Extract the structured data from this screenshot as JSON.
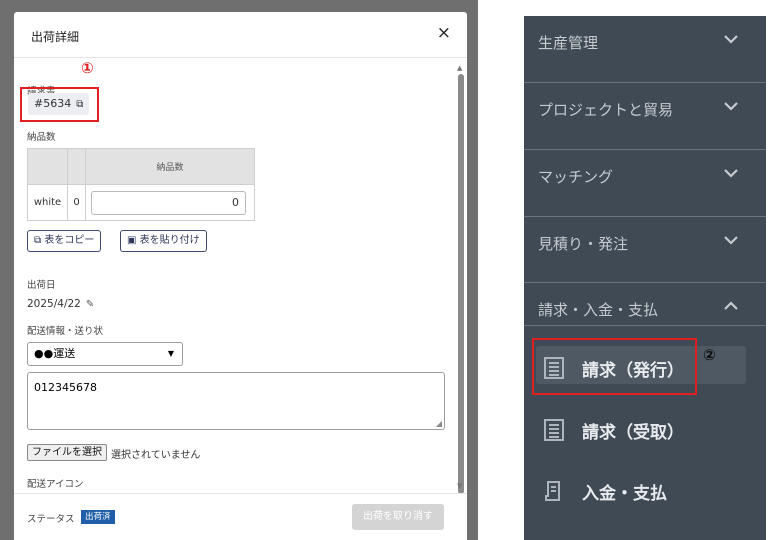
{
  "modal": {
    "title": "出荷詳細",
    "close": "×",
    "invoice_label": "請求書",
    "invoice_number": "#5634",
    "annotation_1": "①",
    "qty_label": "納品数",
    "qty_table": {
      "header": "納品数",
      "row_label": "white",
      "row_count": "0",
      "input_value": "0"
    },
    "copy_table": "表をコピー",
    "paste_table": "表を貼り付け",
    "ship_date_label": "出荷日",
    "ship_date": "2025/4/22",
    "delivery_label": "配送情報・送り状",
    "carrier": "●●運送",
    "tracking": "012345678",
    "file_button": "ファイルを選択",
    "file_status": "選択されていません",
    "ship_icon_label": "配送アイコン",
    "footer": {
      "status_label": "ステータス",
      "status_badge": "出荷済",
      "cancel_button": "出荷を取り消す"
    }
  },
  "sidebar": {
    "sections": [
      {
        "label": "生産管理",
        "state": "collapsed"
      },
      {
        "label": "プロジェクトと貿易",
        "state": "collapsed"
      },
      {
        "label": "マッチング",
        "state": "collapsed"
      },
      {
        "label": "見積り・発注",
        "state": "collapsed"
      },
      {
        "label": "請求・入金・支払",
        "state": "expanded"
      }
    ],
    "subitems": [
      {
        "label": "請求（発行）",
        "icon": "document-lines-icon"
      },
      {
        "label": "請求（受取）",
        "icon": "document-lines-icon"
      },
      {
        "label": "入金・支払",
        "icon": "receipt-icon"
      }
    ],
    "annotation_2": "②"
  },
  "colors": {
    "sidebar_bg": "#3f4a55",
    "highlight": "#e02020",
    "status_badge": "#1f5fa8"
  }
}
